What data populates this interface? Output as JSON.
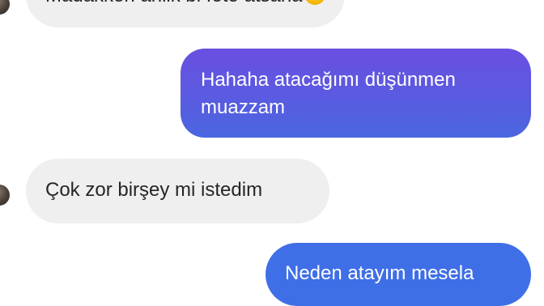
{
  "messages": [
    {
      "direction": "incoming",
      "text": "Madakken ahlik bi foto atsana",
      "emoji": "smiling-face-emoji",
      "partially_visible": true
    },
    {
      "direction": "outgoing",
      "line1": "Hahaha atacağımı düşünmen",
      "line2": "muazzam"
    },
    {
      "direction": "incoming",
      "text": "Çok zor birşey mi istedim"
    },
    {
      "direction": "outgoing",
      "text": "Neden atayım mesela"
    }
  ],
  "colors": {
    "incoming_bubble": "#efefef",
    "incoming_text": "#262626",
    "outgoing_gradient_top": "#6a4fe0",
    "outgoing_gradient_bottom": "#4169e1",
    "outgoing_solid": "#3f6fe6",
    "outgoing_text": "#ffffff"
  }
}
